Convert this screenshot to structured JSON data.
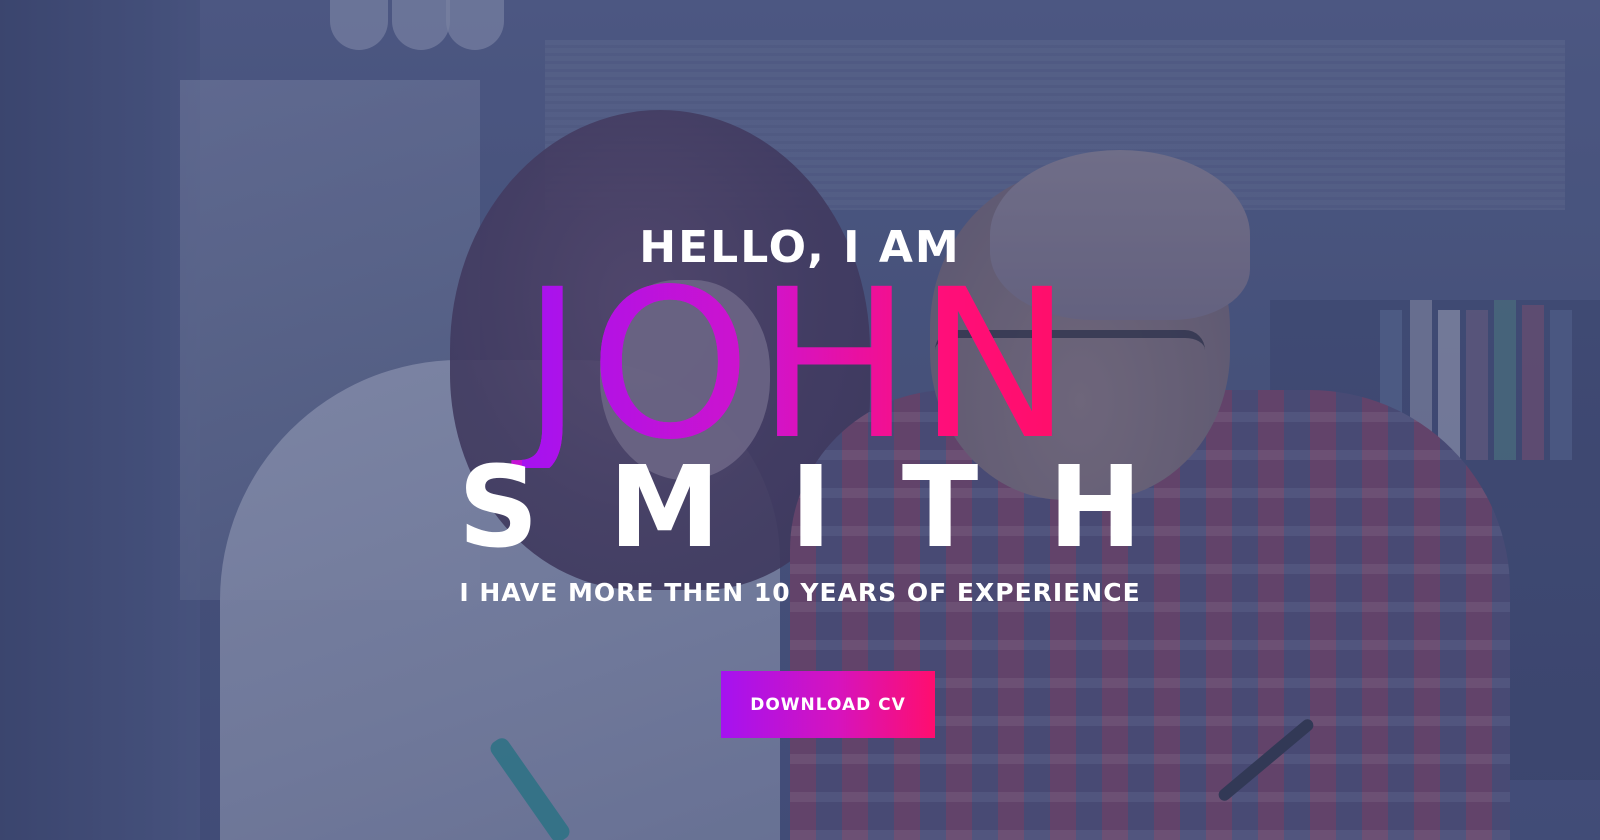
{
  "hero": {
    "greeting": "HELLO, I AM",
    "first_name": "JOHN",
    "last_name": "SMITH",
    "tagline": "I HAVE MORE THEN 10 YEARS OF EXPERIENCE",
    "cta_label": "DOWNLOAD CV"
  },
  "colors": {
    "gradient_start": "#a512f0",
    "gradient_end": "#ff0e6e",
    "overlay": "#3a4473",
    "text": "#ffffff"
  }
}
